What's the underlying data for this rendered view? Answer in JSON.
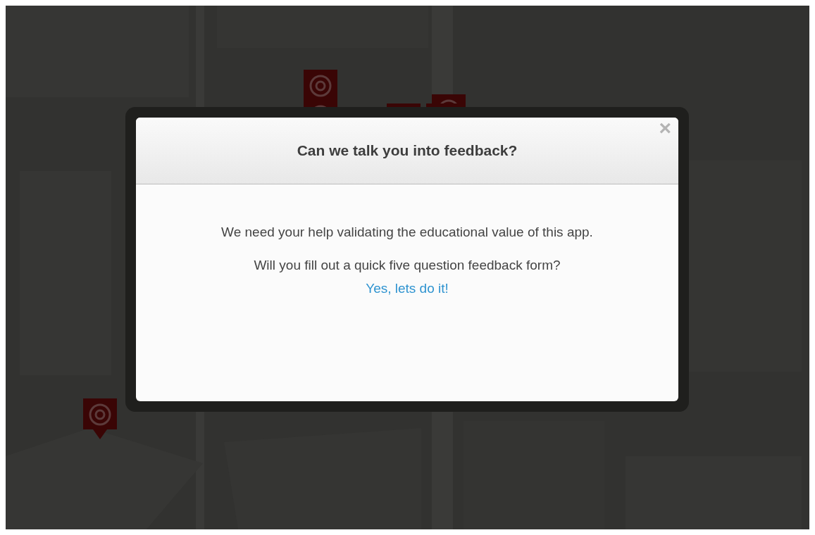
{
  "modal": {
    "title": "Can we talk you into feedback?",
    "close": "×",
    "message": "We need your help validating the educational value of this app. Will you fill out a quick five question feedback form?",
    "link": "Yes, lets do it!"
  }
}
